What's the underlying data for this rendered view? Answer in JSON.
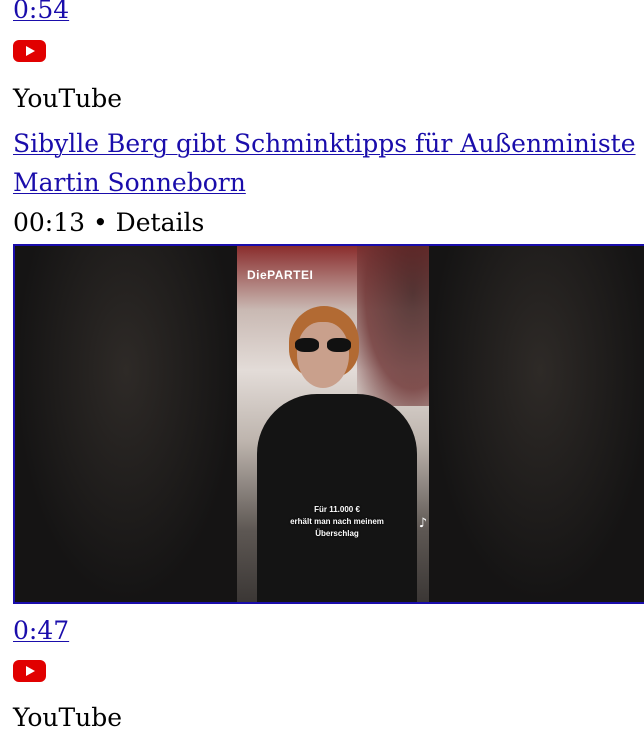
{
  "items": [
    {
      "duration": "0:54",
      "source": "YouTube",
      "title": "Sibylle Berg gibt Schminktipps für Außenministe",
      "channel": "Martin Sonneborn",
      "meta": "00:13 • Details"
    },
    {
      "duration": "0:47",
      "source": "YouTube"
    }
  ],
  "video": {
    "logo_text": "DiePARTEI",
    "caption_lines": [
      "Für 11.000 €",
      "erhält man nach meinem",
      "Überschlag"
    ],
    "tiktok_icon": "tiktok-icon",
    "tiktok_label": "TikTok"
  },
  "colors": {
    "link": "#1a0dab",
    "youtube_red": "#e10000"
  }
}
